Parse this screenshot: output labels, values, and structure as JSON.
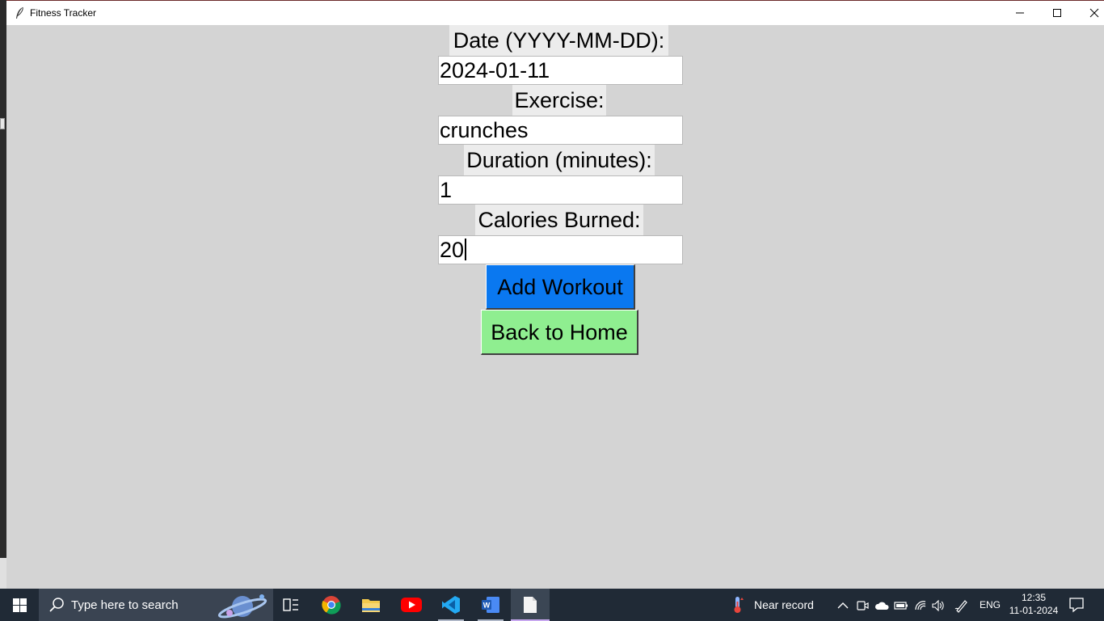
{
  "window": {
    "title": "Fitness Tracker"
  },
  "form": {
    "date_label": "Date (YYYY-MM-DD):",
    "date_value": "2024-01-11",
    "exercise_label": "Exercise:",
    "exercise_value": "crunches",
    "duration_label": "Duration (minutes):",
    "duration_value": "1",
    "calories_label": "Calories Burned:",
    "calories_value": "20",
    "add_button": "Add Workout",
    "back_button": "Back to Home"
  },
  "colors": {
    "window_bg": "#d4d4d4",
    "add_button_bg": "#0a78f0",
    "back_button_bg": "#8fee90",
    "taskbar_bg": "#202a36"
  },
  "taskbar": {
    "search_placeholder": "Type here to search",
    "apps": [
      "task-view-icon",
      "chrome-icon",
      "file-explorer-icon",
      "youtube-icon",
      "vscode-icon",
      "word-icon",
      "notepad-icon"
    ],
    "weather_text": "Near record",
    "language": "ENG",
    "time": "12:35",
    "date": "11-01-2024"
  }
}
